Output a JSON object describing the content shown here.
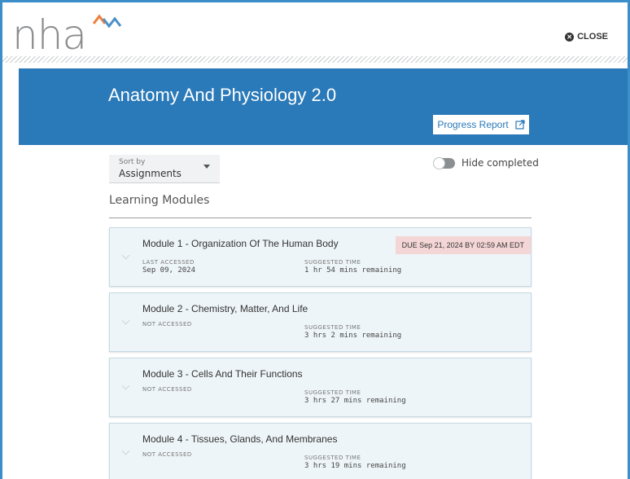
{
  "header": {
    "logo_text": "nha",
    "close_label": "CLOSE",
    "close_icon": "close-circle-icon"
  },
  "banner": {
    "course_title": "Anatomy And Physiology 2.0",
    "progress_report_label": "Progress Report",
    "progress_report_icon": "external-link-icon"
  },
  "controls": {
    "sort_label": "Sort by",
    "sort_value": "Assignments",
    "hide_completed_label": "Hide completed",
    "hide_completed_on": false
  },
  "section": {
    "title": "Learning Modules"
  },
  "modules": [
    {
      "title": "Module 1 - Organization Of The Human Body",
      "accessed_label": "LAST ACCESSED",
      "accessed_date": "Sep 09, 2024",
      "time_label": "SUGGESTED TIME",
      "time_remaining": "1 hr 54 mins remaining",
      "due": "DUE Sep 21, 2024 BY 02:59 AM EDT"
    },
    {
      "title": "Module 2 - Chemistry, Matter, And Life",
      "accessed_label": "NOT ACCESSED",
      "accessed_date": "",
      "time_label": "SUGGESTED TIME",
      "time_remaining": "3 hrs 2 mins remaining",
      "due": ""
    },
    {
      "title": "Module 3 - Cells And Their Functions",
      "accessed_label": "NOT ACCESSED",
      "accessed_date": "",
      "time_label": "SUGGESTED TIME",
      "time_remaining": "3 hrs 27 mins remaining",
      "due": ""
    },
    {
      "title": "Module 4 - Tissues, Glands, And Membranes",
      "accessed_label": "NOT ACCESSED",
      "accessed_date": "",
      "time_label": "SUGGESTED TIME",
      "time_remaining": "3 hrs 19 mins remaining",
      "due": ""
    }
  ],
  "colors": {
    "brand_blue": "#2a79b8",
    "frame_blue": "#3b8ec9",
    "due_bg": "#f5d6d6",
    "module_bg": "#eef5f8",
    "logo_orange": "#f07d3a",
    "logo_blue": "#4a90c8"
  }
}
